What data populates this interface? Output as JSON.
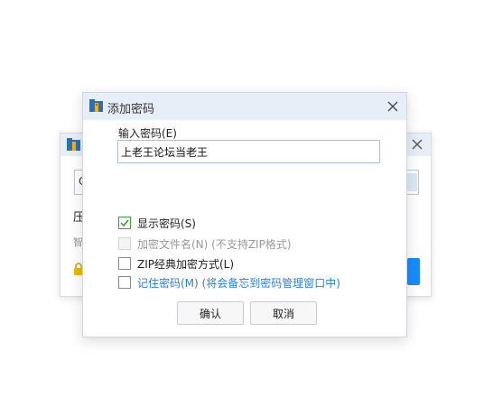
{
  "background_dialog": {
    "input_value": "C",
    "label_compress": "压",
    "label_hint": "智",
    "colors": {
      "accent": "#1a8cff"
    }
  },
  "dialog": {
    "title": "添加密码",
    "icon": "winrar-archive-icon",
    "password_label": "输入密码(E)",
    "password_value": "上老王论坛当老王",
    "options": [
      {
        "label": "显示密码(S)",
        "checked": true,
        "disabled": false
      },
      {
        "label": "加密文件名(N) (不支持ZIP格式)",
        "checked": false,
        "disabled": true
      },
      {
        "label": "ZIP经典加密方式(L)",
        "checked": false,
        "disabled": false
      },
      {
        "label": "记住密码(M) (将会备忘到密码管理窗口中)",
        "checked": false,
        "disabled": false
      }
    ],
    "buttons": {
      "ok": "确认",
      "cancel": "取消"
    }
  }
}
